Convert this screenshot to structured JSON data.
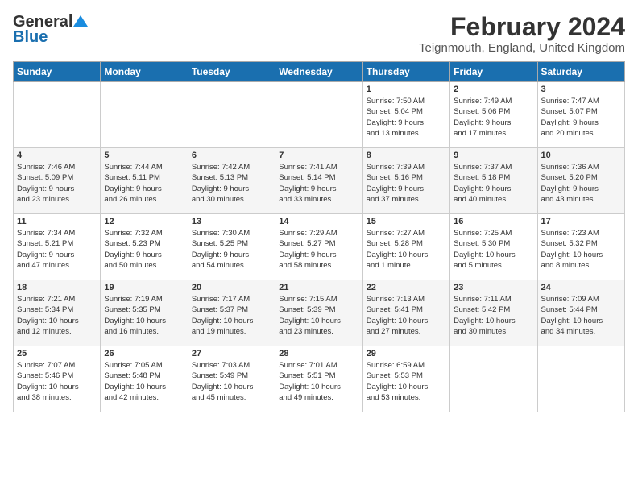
{
  "logo": {
    "line1": "General",
    "line2": "Blue"
  },
  "title": "February 2024",
  "location": "Teignmouth, England, United Kingdom",
  "days_header": [
    "Sunday",
    "Monday",
    "Tuesday",
    "Wednesday",
    "Thursday",
    "Friday",
    "Saturday"
  ],
  "weeks": [
    [
      {
        "day": "",
        "info": ""
      },
      {
        "day": "",
        "info": ""
      },
      {
        "day": "",
        "info": ""
      },
      {
        "day": "",
        "info": ""
      },
      {
        "day": "1",
        "info": "Sunrise: 7:50 AM\nSunset: 5:04 PM\nDaylight: 9 hours\nand 13 minutes."
      },
      {
        "day": "2",
        "info": "Sunrise: 7:49 AM\nSunset: 5:06 PM\nDaylight: 9 hours\nand 17 minutes."
      },
      {
        "day": "3",
        "info": "Sunrise: 7:47 AM\nSunset: 5:07 PM\nDaylight: 9 hours\nand 20 minutes."
      }
    ],
    [
      {
        "day": "4",
        "info": "Sunrise: 7:46 AM\nSunset: 5:09 PM\nDaylight: 9 hours\nand 23 minutes."
      },
      {
        "day": "5",
        "info": "Sunrise: 7:44 AM\nSunset: 5:11 PM\nDaylight: 9 hours\nand 26 minutes."
      },
      {
        "day": "6",
        "info": "Sunrise: 7:42 AM\nSunset: 5:13 PM\nDaylight: 9 hours\nand 30 minutes."
      },
      {
        "day": "7",
        "info": "Sunrise: 7:41 AM\nSunset: 5:14 PM\nDaylight: 9 hours\nand 33 minutes."
      },
      {
        "day": "8",
        "info": "Sunrise: 7:39 AM\nSunset: 5:16 PM\nDaylight: 9 hours\nand 37 minutes."
      },
      {
        "day": "9",
        "info": "Sunrise: 7:37 AM\nSunset: 5:18 PM\nDaylight: 9 hours\nand 40 minutes."
      },
      {
        "day": "10",
        "info": "Sunrise: 7:36 AM\nSunset: 5:20 PM\nDaylight: 9 hours\nand 43 minutes."
      }
    ],
    [
      {
        "day": "11",
        "info": "Sunrise: 7:34 AM\nSunset: 5:21 PM\nDaylight: 9 hours\nand 47 minutes."
      },
      {
        "day": "12",
        "info": "Sunrise: 7:32 AM\nSunset: 5:23 PM\nDaylight: 9 hours\nand 50 minutes."
      },
      {
        "day": "13",
        "info": "Sunrise: 7:30 AM\nSunset: 5:25 PM\nDaylight: 9 hours\nand 54 minutes."
      },
      {
        "day": "14",
        "info": "Sunrise: 7:29 AM\nSunset: 5:27 PM\nDaylight: 9 hours\nand 58 minutes."
      },
      {
        "day": "15",
        "info": "Sunrise: 7:27 AM\nSunset: 5:28 PM\nDaylight: 10 hours\nand 1 minute."
      },
      {
        "day": "16",
        "info": "Sunrise: 7:25 AM\nSunset: 5:30 PM\nDaylight: 10 hours\nand 5 minutes."
      },
      {
        "day": "17",
        "info": "Sunrise: 7:23 AM\nSunset: 5:32 PM\nDaylight: 10 hours\nand 8 minutes."
      }
    ],
    [
      {
        "day": "18",
        "info": "Sunrise: 7:21 AM\nSunset: 5:34 PM\nDaylight: 10 hours\nand 12 minutes."
      },
      {
        "day": "19",
        "info": "Sunrise: 7:19 AM\nSunset: 5:35 PM\nDaylight: 10 hours\nand 16 minutes."
      },
      {
        "day": "20",
        "info": "Sunrise: 7:17 AM\nSunset: 5:37 PM\nDaylight: 10 hours\nand 19 minutes."
      },
      {
        "day": "21",
        "info": "Sunrise: 7:15 AM\nSunset: 5:39 PM\nDaylight: 10 hours\nand 23 minutes."
      },
      {
        "day": "22",
        "info": "Sunrise: 7:13 AM\nSunset: 5:41 PM\nDaylight: 10 hours\nand 27 minutes."
      },
      {
        "day": "23",
        "info": "Sunrise: 7:11 AM\nSunset: 5:42 PM\nDaylight: 10 hours\nand 30 minutes."
      },
      {
        "day": "24",
        "info": "Sunrise: 7:09 AM\nSunset: 5:44 PM\nDaylight: 10 hours\nand 34 minutes."
      }
    ],
    [
      {
        "day": "25",
        "info": "Sunrise: 7:07 AM\nSunset: 5:46 PM\nDaylight: 10 hours\nand 38 minutes."
      },
      {
        "day": "26",
        "info": "Sunrise: 7:05 AM\nSunset: 5:48 PM\nDaylight: 10 hours\nand 42 minutes."
      },
      {
        "day": "27",
        "info": "Sunrise: 7:03 AM\nSunset: 5:49 PM\nDaylight: 10 hours\nand 45 minutes."
      },
      {
        "day": "28",
        "info": "Sunrise: 7:01 AM\nSunset: 5:51 PM\nDaylight: 10 hours\nand 49 minutes."
      },
      {
        "day": "29",
        "info": "Sunrise: 6:59 AM\nSunset: 5:53 PM\nDaylight: 10 hours\nand 53 minutes."
      },
      {
        "day": "",
        "info": ""
      },
      {
        "day": "",
        "info": ""
      }
    ]
  ]
}
